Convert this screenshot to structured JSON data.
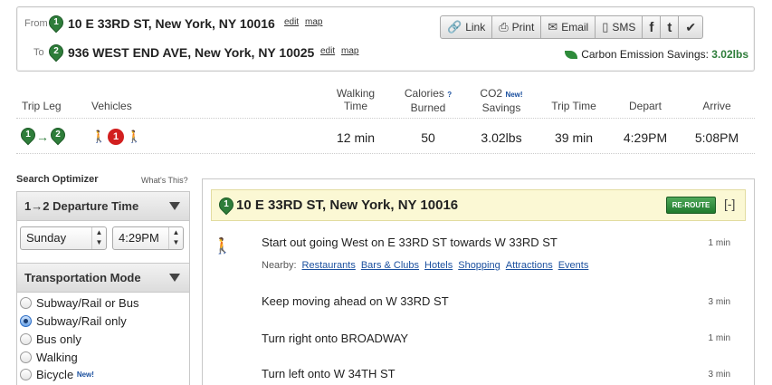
{
  "trip": {
    "from_label": "From",
    "to_label": "To",
    "from_marker": "1",
    "to_marker": "2",
    "from_address": "10 E 33RD ST, New York, NY 10016",
    "to_address": "936 WEST END AVE, New York, NY 10025",
    "edit_label": "edit",
    "map_label": "map"
  },
  "share_buttons": {
    "link": "Link",
    "print": "Print",
    "email": "Email",
    "sms": "SMS",
    "facebook_glyph": "f",
    "twitter_glyph": "t",
    "check_glyph": "✔"
  },
  "carbon": {
    "label": "Carbon Emission Savings:",
    "value": "3.02lbs"
  },
  "summary_headers": {
    "trip_leg": "Trip Leg",
    "vehicles": "Vehicles",
    "walking_time_1": "Walking",
    "walking_time_2": "Time",
    "calories_1": "Calories",
    "calories_help": "?",
    "calories_2": "Burned",
    "co2_1": "CO2",
    "co2_new": "New!",
    "co2_2": "Savings",
    "trip_time": "Trip Time",
    "depart": "Depart",
    "arrive": "Arrive"
  },
  "summary_row": {
    "leg_from": "1",
    "leg_to": "2",
    "bus_number": "1",
    "walking_time": "12 min",
    "calories": "50",
    "co2_savings": "3.02lbs",
    "trip_time": "39 min",
    "depart": "4:29PM",
    "arrive": "5:08PM"
  },
  "optimizer": {
    "title": "Search Optimizer",
    "whats_this": "What's This?",
    "departure_header": "1→2 Departure Time",
    "day_value": "Sunday",
    "time_value": "4:29PM",
    "mode_header": "Transportation Mode",
    "modes": [
      {
        "label": "Subway/Rail or Bus",
        "selected": false,
        "new": ""
      },
      {
        "label": "Subway/Rail only",
        "selected": true,
        "new": ""
      },
      {
        "label": "Bus only",
        "selected": false,
        "new": ""
      },
      {
        "label": "Walking",
        "selected": false,
        "new": ""
      },
      {
        "label": "Bicycle",
        "selected": false,
        "new": "New!"
      }
    ]
  },
  "directions": {
    "marker": "1",
    "start_address": "10 E 33RD ST, New York, NY 10016",
    "reroute_label": "RE-ROUTE",
    "collapse_label": "[-]",
    "nearby_label": "Nearby:",
    "nearby_links": [
      "Restaurants",
      "Bars & Clubs",
      "Hotels",
      "Shopping",
      "Attractions",
      "Events"
    ],
    "steps": [
      {
        "text": "Start out going West on E 33RD ST towards W 33RD ST",
        "duration": "1 min"
      },
      {
        "text": "Keep moving ahead on W 33RD ST",
        "duration": "3 min"
      },
      {
        "text": "Turn right onto BROADWAY",
        "duration": "1 min"
      },
      {
        "text": "Turn left onto W 34TH ST",
        "duration": "3 min"
      }
    ]
  },
  "colors": {
    "brand_green": "#2e7d3a",
    "bus_red": "#d21f1f",
    "link_blue": "#1a4f9e",
    "highlight_yellow": "#fbf8d4"
  }
}
